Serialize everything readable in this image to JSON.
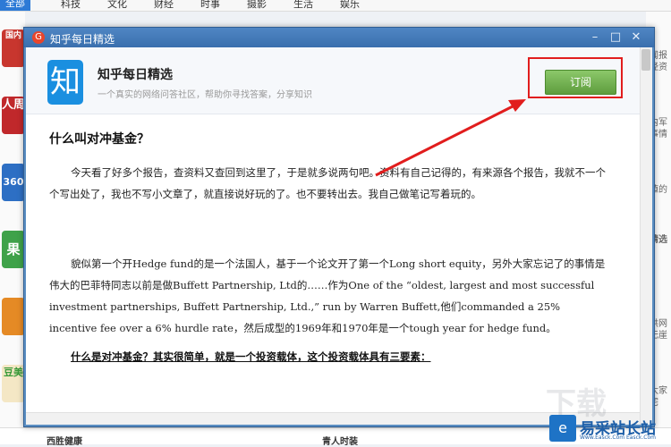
{
  "top_nav": [
    "全部",
    "科技",
    "文化",
    "财经",
    "时事",
    "摄影",
    "生活",
    "娱乐"
  ],
  "bg_left_apps": [
    "国内",
    "人周",
    "360",
    "果",
    "",
    "豆美"
  ],
  "bg_right_fragments": [
    "闻报\n经资",
    "内军\n事情",
    "値的",
    "精选",
    "供网\n无崖",
    "太家\n宅"
  ],
  "bg_bottom": [
    "西胜健康",
    "青人时装"
  ],
  "window": {
    "title": "知乎每日精选",
    "logo_glyph": "G"
  },
  "header": {
    "logo_char": "知",
    "app_name": "知乎每日精选",
    "app_desc": "一个真实的网络问答社区，帮助你寻找答案，分享知识",
    "subscribe_label": "订阅"
  },
  "article": {
    "title": "什么叫对冲基金？",
    "para1": "今天看了好多个报告，查资料又查回到这里了，于是就多说两句吧。资料有自己记得的，有来源各个报告，我就不一个个写出处了，我也不写小文章了，就直接说好玩的了。也不要转出去。我自己做笔记写着玩的。",
    "para2": "貌似第一个开Hedge fund的是一个法国人，基于一个论文开了第一个Long short equity，另外大家忘记了的事情是伟大的巴菲特同志以前是做Buffett Partnership, Ltd的……作为One of the “oldest, largest and most successful investment partnerships, Buffett Partnership, Ltd.,” run by Warren Buffett,他们commanded a 25% incentive fee over a 6% hurdle rate，然后成型的1969年和1970年是一个tough year for hedge fund。",
    "subheading": "什么是对冲基金？其实很简单，就是一个投资载体，这个投资载体具有三要素："
  },
  "watermark": {
    "site": "易采站长站",
    "site_sub": "Www.Easck.Com  Easck.Com"
  },
  "colors": {
    "titlebar": "#3a6fae",
    "subscribe_green": "#5e9d3e",
    "annotation_red": "#e11d1d",
    "zhihu_blue": "#1a8fe0"
  }
}
